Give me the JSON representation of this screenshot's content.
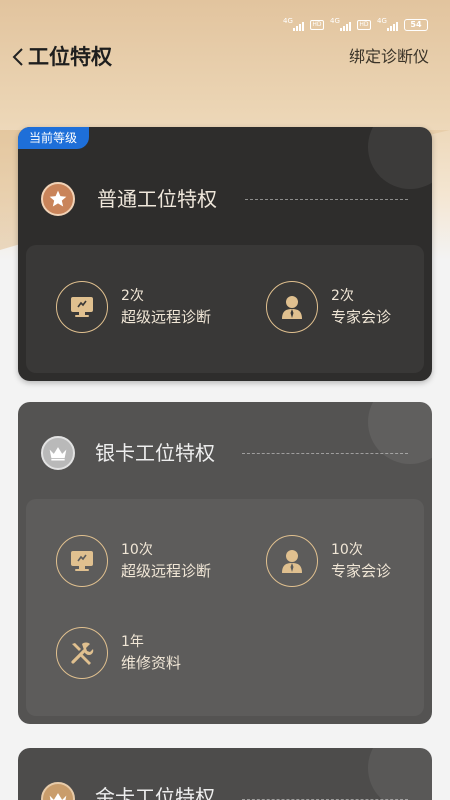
{
  "status_bar": {
    "network_1": "4G",
    "network_2": "4G",
    "network_3": "4G",
    "hd_1": "HD",
    "hd_2": "HD",
    "battery": "54"
  },
  "header": {
    "title": "工位特权",
    "right_action": "绑定诊断仪"
  },
  "tiers": [
    {
      "title": "普通工位特权",
      "badge": "当前等级",
      "perks": [
        {
          "count": "2次",
          "label": "超级远程诊断",
          "icon": "monitor-icon"
        },
        {
          "count": "2次",
          "label": "专家会诊",
          "icon": "expert-icon"
        }
      ]
    },
    {
      "title": "银卡工位特权",
      "perks": [
        {
          "count": "10次",
          "label": "超级远程诊断",
          "icon": "monitor-icon"
        },
        {
          "count": "10次",
          "label": "专家会诊",
          "icon": "expert-icon"
        },
        {
          "count": "1年",
          "label": "维修资料",
          "icon": "tools-icon"
        }
      ]
    },
    {
      "title": "金卡工位特权"
    }
  ],
  "colors": {
    "accent_gold": "#e0c08f",
    "badge_blue": "#1e6fd9",
    "card_dark": "#2e2d2c",
    "card_silver": "#545352"
  }
}
